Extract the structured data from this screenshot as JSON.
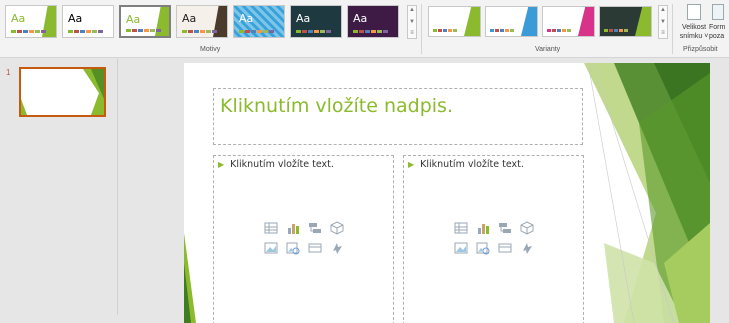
{
  "ribbon": {
    "themes_group_label": "Motivy",
    "variants_group_label": "Varianty",
    "customize_group_label": "Přizpůsobit",
    "themes": [
      {
        "name": "theme-facet",
        "aa": "Aa",
        "bg": "#ffffff",
        "accent": "#8cba2e",
        "aa_color": "#8cba2e",
        "selected": false
      },
      {
        "name": "theme-office",
        "aa": "Aa",
        "bg": "#ffffff",
        "accent": "#ffffff",
        "aa_color": "#000000",
        "selected": false
      },
      {
        "name": "theme-facet-green",
        "aa": "Aa",
        "bg": "#ffffff",
        "accent": "#8cba2e",
        "aa_color": "#8cba2e",
        "selected": true
      },
      {
        "name": "theme-brown",
        "aa": "Aa",
        "bg": "#f5f0ea",
        "accent": "#4a3b2c",
        "aa_color": "#222222",
        "selected": false
      },
      {
        "name": "theme-pattern",
        "aa": "Aa",
        "bg": "#3aa0d8",
        "accent": "#3aa0d8",
        "aa_color": "#ffffff",
        "selected": false
      },
      {
        "name": "theme-dark-teal",
        "aa": "Aa",
        "bg": "#1e3a40",
        "accent": "#1e3a40",
        "aa_color": "#ffffff",
        "selected": false
      },
      {
        "name": "theme-purple",
        "aa": "Aa",
        "bg": "#3d1b45",
        "accent": "#3d1b45",
        "aa_color": "#ffffff",
        "selected": false
      }
    ],
    "variants": [
      {
        "name": "variant-green",
        "bg": "#ffffff",
        "accent": "#8cba2e"
      },
      {
        "name": "variant-blue",
        "bg": "#ffffff",
        "accent": "#3a9bd8"
      },
      {
        "name": "variant-pink",
        "bg": "#ffffff",
        "accent": "#d9328a"
      },
      {
        "name": "variant-dark",
        "bg": "#2c3a36",
        "accent": "#8cba2e"
      }
    ],
    "slide_size_label_1": "Velikost",
    "slide_size_label_2": "snímku ˅",
    "format_bg_label_1": "Form",
    "format_bg_label_2": "poza"
  },
  "thumbnails": {
    "slide_number": "1"
  },
  "slide": {
    "title_placeholder": "Kliknutím vložíte nadpis.",
    "left_content_placeholder": "Kliknutím vložíte text.",
    "right_content_placeholder": "Kliknutím vložíte text.",
    "content_icons": [
      "table-icon",
      "chart-icon",
      "smartart-icon",
      "3d-model-icon",
      "picture-icon",
      "online-picture-icon",
      "video-icon",
      "icons-icon"
    ]
  },
  "colors": {
    "accent_green": "#8cba2e",
    "dark_green": "#3f7d20",
    "slide_thumb_border": "#c55a11"
  }
}
